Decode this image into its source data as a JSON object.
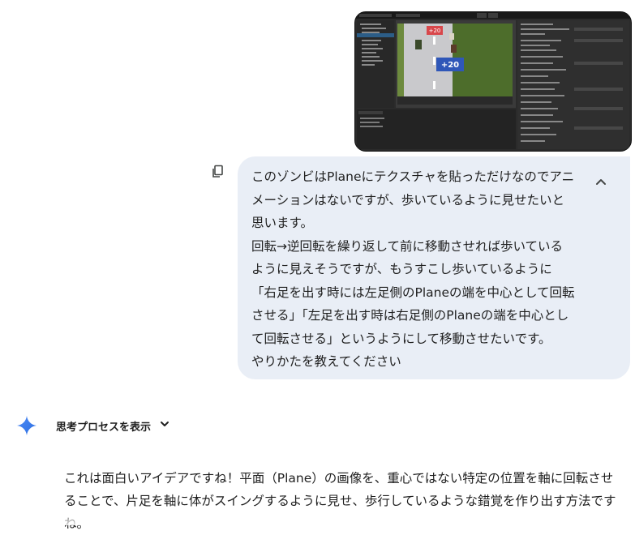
{
  "attachment": {
    "preview_alt": "Unity editor screenshot",
    "game_labels": [
      "+20",
      "+20"
    ]
  },
  "user_message": {
    "text": "このゾンビはPlaneにテクスチャを貼っただけなのでアニ\nメーションはないですが、歩いているように見せたいと\n思います。\n回転→逆回転を繰り返して前に移動させれば歩いている\nように見えそうですが、もうすこし歩いているように\n「右足を出す時には左足側のPlaneの端を中心として回転\nさせる」「左足を出す時は右足側のPlaneの端を中心とし\nて回転させる」というようにして移動させたいです。\nやりかたを教えてください",
    "copy_icon": "copy-icon",
    "collapse_icon": "chevron-up-icon"
  },
  "assistant": {
    "avatar_icon": "gemini-sparkle-icon",
    "thought_label": "思考プロセスを表示",
    "thought_icon": "chevron-down-icon",
    "response": "これは面白いアイデアですね！平面（Plane）の画像を、重心ではない特定の位置を軸に回転させることで、片足を軸に体がスイングするように見せ、歩行しているような錯覚を作り出す方法ですね。"
  },
  "colors": {
    "bubble_bg": "#e9eef6",
    "text": "#1f1f1f",
    "gemini_blue": "#4285f4"
  }
}
